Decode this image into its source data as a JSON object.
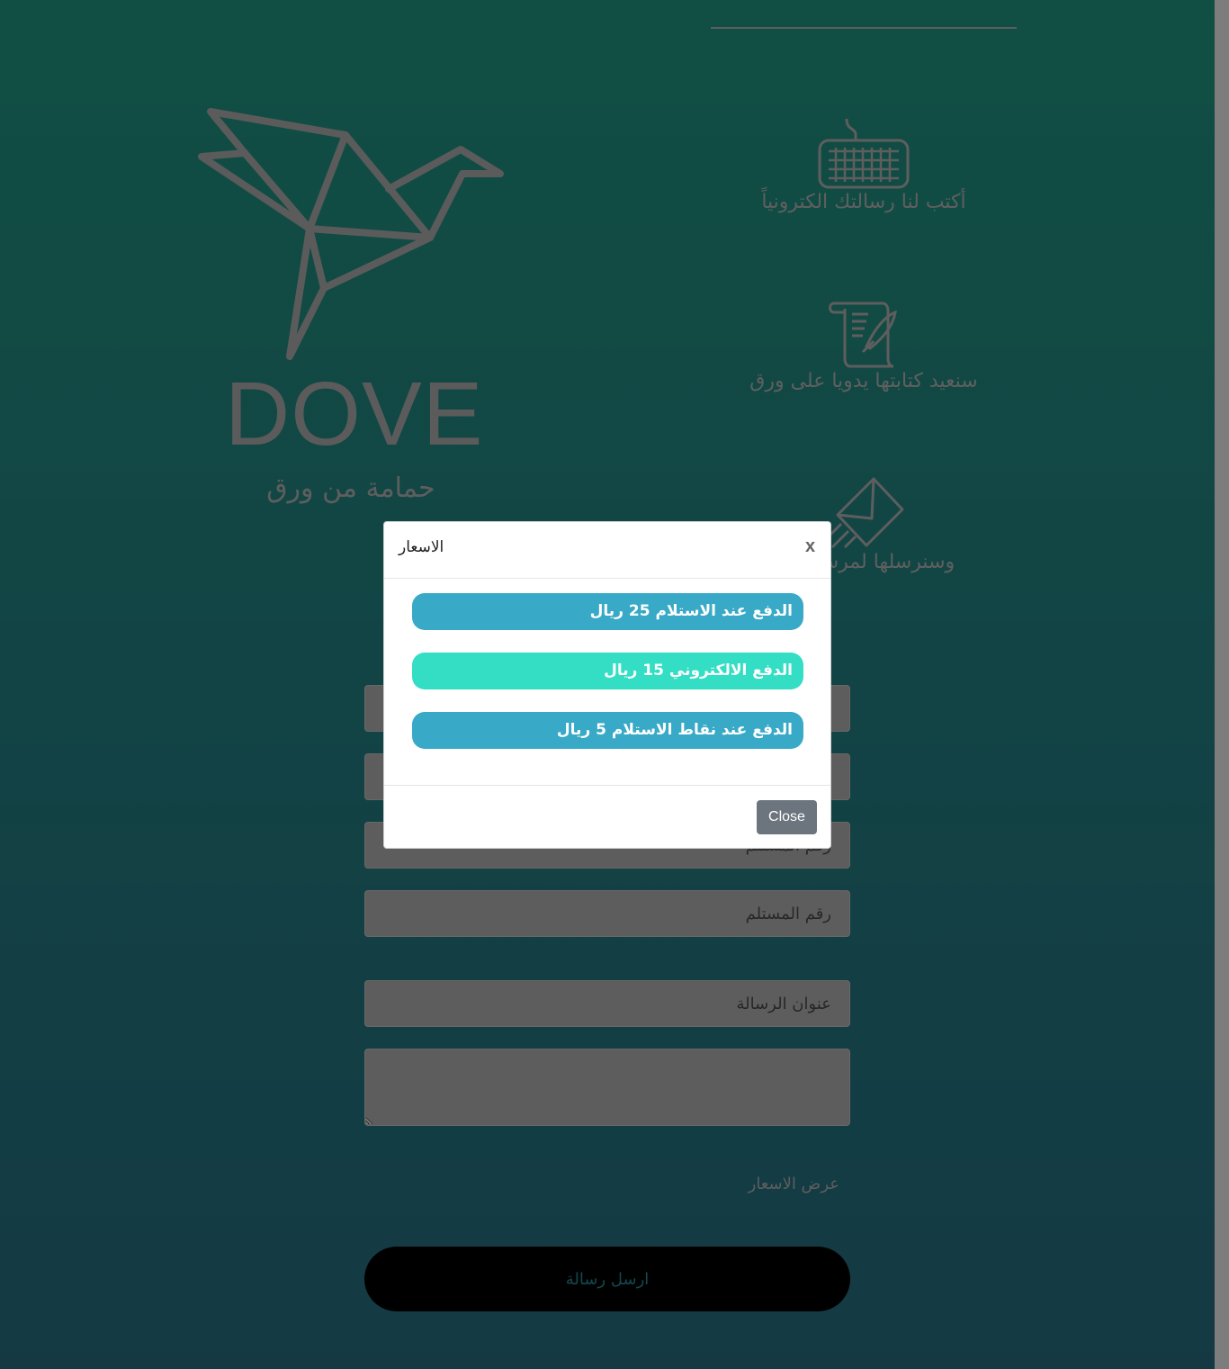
{
  "brand": {
    "name": "DOVE",
    "tagline": "حمامة من ورق"
  },
  "steps": [
    {
      "label": "أكتب لنا رسالتك الكترونياً",
      "icon": "keyboard-icon"
    },
    {
      "label": "سنعيد كتابتها يدويا على ورق",
      "icon": "scroll-quill-icon"
    },
    {
      "label": "وسنرسلها لمرسل إليه",
      "icon": "envelope-send-icon"
    }
  ],
  "form": {
    "receiver_number_placeholder": "رقم المستلم",
    "receiver_number_placeholder_2": "رقم المستلم",
    "subject_placeholder": "عنوان الرسالة",
    "prices_link": "عرض الاسعار",
    "send_button": "ارسل رسالة"
  },
  "modal": {
    "title": "الاسعار",
    "close_x": "x",
    "options": [
      {
        "label": "الدفع عند الاستلام 25 ريال",
        "style": "blue"
      },
      {
        "label": "الدفع الالكتروني 15 ريال",
        "style": "teal"
      },
      {
        "label": "الدفع عند نقاط الاستلام 5 ريال",
        "style": "blue"
      }
    ],
    "close_button": "Close"
  },
  "colors": {
    "background_top": "#1a7565",
    "background_bottom": "#1e5564",
    "option_blue": "#38a9c6",
    "option_teal": "#33dec5",
    "close_button": "#6c757d"
  }
}
